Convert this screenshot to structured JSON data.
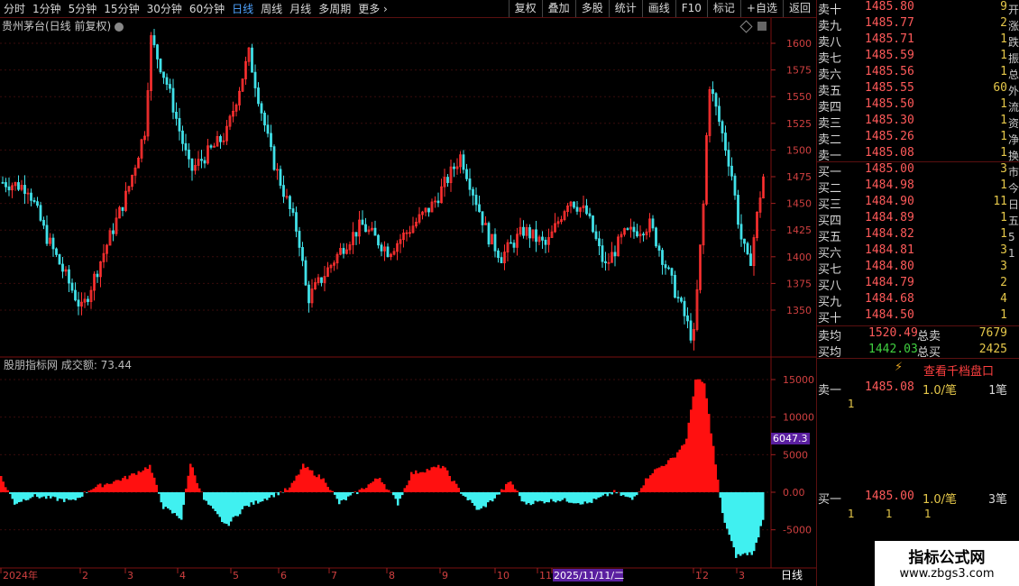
{
  "toolbar": {
    "periods": [
      "分时",
      "1分钟",
      "5分钟",
      "15分钟",
      "30分钟",
      "60分钟",
      "日线",
      "周线",
      "月线",
      "多周期",
      "更多"
    ],
    "active_period": "日线",
    "more_arrow": "chevron-right-icon",
    "right_buttons": [
      "复权",
      "叠加",
      "多股",
      "统计",
      "画线",
      "F10",
      "标记",
      "+自选",
      "返回"
    ]
  },
  "chart": {
    "title": "贵州茅台(日线 前复权)",
    "price_ticks": [
      "1600",
      "1575",
      "1550",
      "1525",
      "1500",
      "1475",
      "1450",
      "1425",
      "1400",
      "1375",
      "1350"
    ],
    "up_color": "#ff3030",
    "down_color": "#40e0e8"
  },
  "indicator": {
    "title": "股朋指标网 成交额: 73.44",
    "ticks": [
      "15000",
      "10000",
      "5000",
      "0.00",
      "-5000"
    ],
    "current_label": "6047.3"
  },
  "xaxis": {
    "labels": [
      "2024年",
      "2",
      "3",
      "4",
      "5",
      "6",
      "7",
      "8",
      "9",
      "10",
      "11",
      "2025/11/11/二",
      "1",
      "2",
      "3"
    ],
    "right_label": "日线"
  },
  "orderbook": {
    "asks": [
      {
        "label": "卖十",
        "price": "1485.80",
        "vol": "9"
      },
      {
        "label": "卖九",
        "price": "1485.77",
        "vol": "2"
      },
      {
        "label": "卖八",
        "price": "1485.71",
        "vol": "1"
      },
      {
        "label": "卖七",
        "price": "1485.59",
        "vol": "1"
      },
      {
        "label": "卖六",
        "price": "1485.56",
        "vol": "1"
      },
      {
        "label": "卖五",
        "price": "1485.55",
        "vol": "60"
      },
      {
        "label": "卖四",
        "price": "1485.50",
        "vol": "1"
      },
      {
        "label": "卖三",
        "price": "1485.30",
        "vol": "1"
      },
      {
        "label": "卖二",
        "price": "1485.26",
        "vol": "1"
      },
      {
        "label": "卖一",
        "price": "1485.08",
        "vol": "1"
      }
    ],
    "bids": [
      {
        "label": "买一",
        "price": "1485.00",
        "vol": "3"
      },
      {
        "label": "买二",
        "price": "1484.98",
        "vol": "1"
      },
      {
        "label": "买三",
        "price": "1484.90",
        "vol": "11"
      },
      {
        "label": "买四",
        "price": "1484.89",
        "vol": "1"
      },
      {
        "label": "买五",
        "price": "1484.82",
        "vol": "1"
      },
      {
        "label": "买六",
        "price": "1484.81",
        "vol": "3"
      },
      {
        "label": "买七",
        "price": "1484.80",
        "vol": "3"
      },
      {
        "label": "买八",
        "price": "1484.79",
        "vol": "2"
      },
      {
        "label": "买九",
        "price": "1484.68",
        "vol": "4"
      },
      {
        "label": "买十",
        "price": "1484.50",
        "vol": "1"
      }
    ],
    "sell_avg_label": "卖均",
    "sell_avg": "1520.49",
    "sell_total_label": "总卖",
    "sell_total": "7679",
    "buy_avg_label": "买均",
    "buy_avg": "1442.03",
    "buy_total_label": "总买",
    "buy_total": "2425",
    "thousand_link": "查看千档盘口",
    "detail_ask": {
      "label": "卖一",
      "price": "1485.08",
      "per": "1.0/笔",
      "count": "1笔",
      "items": [
        "1"
      ]
    },
    "detail_bid": {
      "label": "买一",
      "price": "1485.00",
      "per": "1.0/笔",
      "count": "3笔",
      "items": [
        "1",
        "1",
        "1"
      ]
    }
  },
  "edge_chars": [
    "开",
    "涨",
    "跌",
    "振",
    "总",
    "外",
    "流",
    "资",
    "净",
    "换",
    "市",
    "今",
    "日",
    "五",
    "5",
    "1"
  ],
  "watermark": {
    "line1": "指标公式网",
    "line2": "www.zbgs3.com"
  }
}
